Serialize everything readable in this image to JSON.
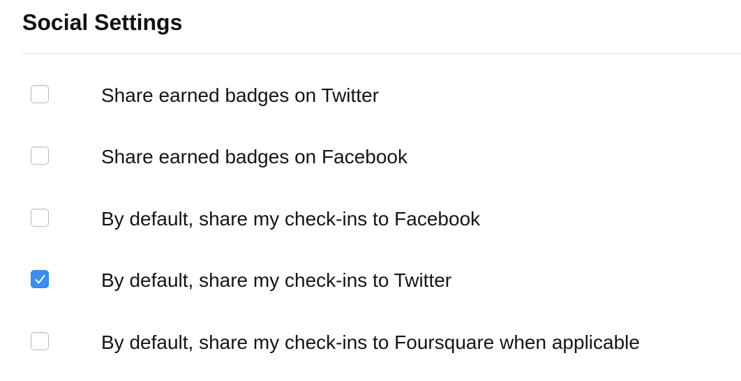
{
  "header": {
    "title": "Social Settings"
  },
  "options": [
    {
      "label": "Share earned badges on Twitter",
      "checked": false
    },
    {
      "label": "Share earned badges on Facebook",
      "checked": false
    },
    {
      "label": "By default, share my check-ins to Facebook",
      "checked": false
    },
    {
      "label": "By default, share my check-ins to Twitter",
      "checked": true
    },
    {
      "label": "By default, share my check-ins to Foursquare when applicable",
      "checked": false
    }
  ],
  "colors": {
    "checkbox_checked": "#3b8ff2",
    "checkbox_border": "#b9b9b9",
    "divider": "#e3e3e3"
  },
  "icons": {
    "checkmark": "checkmark-icon"
  }
}
